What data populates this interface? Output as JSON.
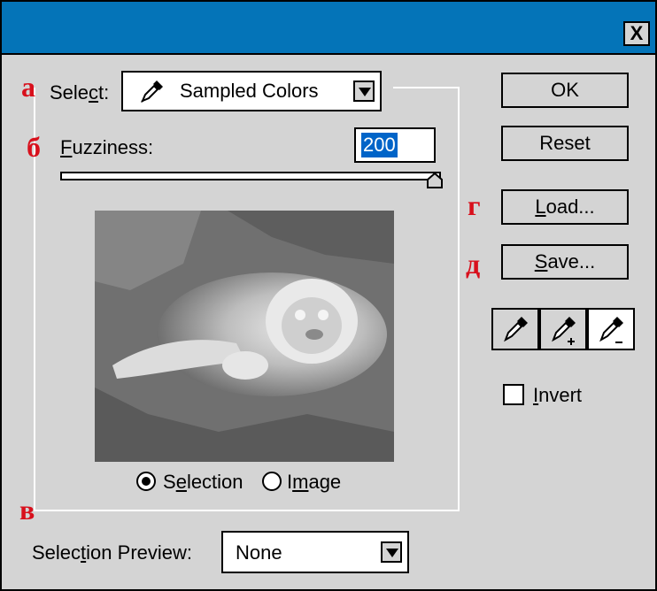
{
  "dialog": {
    "close_label": "X"
  },
  "annotations": {
    "a": "а",
    "b": "б",
    "v": "в",
    "g": "г",
    "d": "д"
  },
  "select": {
    "label_pre": "Sele",
    "label_key": "c",
    "label_post": "t:",
    "value": "Sampled Colors",
    "icon": "eyedropper-icon"
  },
  "fuzziness": {
    "label_key": "F",
    "label_post": "uzziness:",
    "value": "200",
    "max": 200,
    "level": 1.0
  },
  "buttons": {
    "ok": "OK",
    "reset": "Reset",
    "load_key": "L",
    "load_post": "oad...",
    "save_key": "S",
    "save_post": "ave..."
  },
  "eyedroppers": [
    "eyedropper-icon",
    "eyedropper-plus-icon",
    "eyedropper-minus-icon"
  ],
  "invert": {
    "label_key": "I",
    "label_post": "nvert",
    "checked": false
  },
  "preview_mode": {
    "selection_pre": "S",
    "selection_key": "e",
    "selection_post": "lection",
    "image_pre": "I",
    "image_key": "m",
    "image_post": "age",
    "selected": "Selection"
  },
  "selection_preview": {
    "label_pre": "Selec",
    "label_key": "t",
    "label_post": "ion Preview:",
    "value": "None"
  },
  "colors": {
    "titlebar": "#0474b8",
    "dialog_bg": "#d4d4d4",
    "annotation": "#d8101c",
    "highlight": "#0064c8"
  }
}
